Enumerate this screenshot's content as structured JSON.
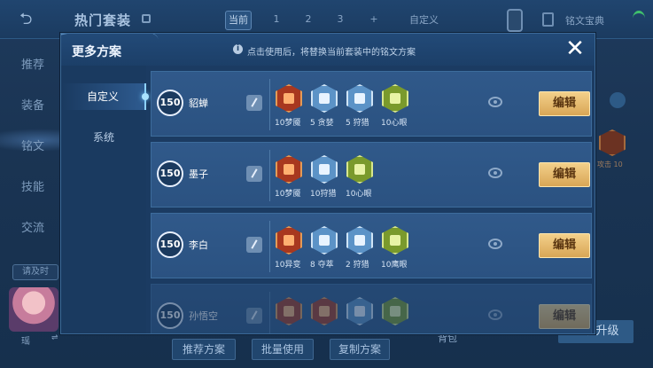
{
  "background": {
    "title": "热门套装",
    "tabs": [
      "当前",
      "1",
      "2",
      "3",
      "+",
      "自定义"
    ],
    "right_label": "铭文宝典",
    "side_items": [
      "推荐",
      "装备",
      "铭文",
      "技能",
      "交流"
    ],
    "invite_label": "请及时",
    "avatar_name": "瑶",
    "right_gem_label": "攻击 10",
    "bottom_buttons": [
      "推荐方案",
      "批量使用",
      "复制方案"
    ],
    "upgrade_label": "一键升级",
    "bag_label": "背包"
  },
  "modal": {
    "title": "更多方案",
    "hint": "点击使用后，将替换当前套装中的铭文方案",
    "close_icon": "close-icon",
    "side_tabs": [
      "自定义",
      "系统"
    ],
    "edit_label": "编辑",
    "schemes": [
      {
        "level": "150",
        "name": "貂蝉",
        "runes": [
          {
            "label": "10梦魇",
            "color": "red"
          },
          {
            "label": "5 贪婪",
            "color": "blue"
          },
          {
            "label": "5 狩猎",
            "color": "blue"
          },
          {
            "label": "10心眼",
            "color": "green"
          }
        ]
      },
      {
        "level": "150",
        "name": "墨子",
        "runes": [
          {
            "label": "10梦魇",
            "color": "red"
          },
          {
            "label": "10狩猎",
            "color": "blue"
          },
          {
            "label": "10心眼",
            "color": "green"
          }
        ]
      },
      {
        "level": "150",
        "name": "李白",
        "runes": [
          {
            "label": "10异变",
            "color": "red"
          },
          {
            "label": "8 夺萃",
            "color": "blue"
          },
          {
            "label": "2 狩猎",
            "color": "blue"
          },
          {
            "label": "10鹰眼",
            "color": "green"
          }
        ]
      },
      {
        "level": "150",
        "name": "孙悟空",
        "runes": [
          {
            "label": "",
            "color": "red"
          },
          {
            "label": "",
            "color": "red"
          },
          {
            "label": "",
            "color": "blue"
          },
          {
            "label": "",
            "color": "green"
          }
        ]
      }
    ]
  },
  "colors": {
    "edit_button": "#e0b062",
    "modal_bg": "#1b3b62",
    "row_bg": "#2d5684"
  }
}
